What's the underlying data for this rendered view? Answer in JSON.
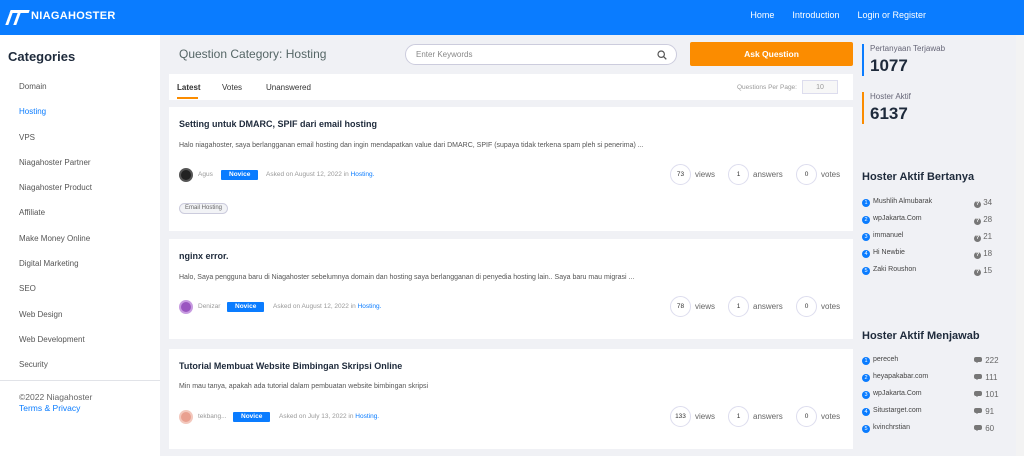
{
  "header": {
    "brand": "NIAGAHOSTER",
    "nav": [
      "Home",
      "Introduction",
      "Login or Register"
    ]
  },
  "sidebar": {
    "title": "Categories",
    "items": [
      "Domain",
      "Hosting",
      "VPS",
      "Niagahoster Partner",
      "Niagahoster Product",
      "Affiliate",
      "Make Money Online",
      "Digital Marketing",
      "SEO",
      "Web Design",
      "Web Development",
      "Security"
    ],
    "active": "Hosting",
    "copyright": "©2022 Niagahoster",
    "terms": "Terms & Privacy"
  },
  "main": {
    "title": "Question Category: Hosting",
    "search_placeholder": "Enter Keywords",
    "ask_label": "Ask Question",
    "tabs": [
      "Latest",
      "Votes",
      "Unanswered"
    ],
    "per_page_label": "Questions Per Page:",
    "per_page_value": "10"
  },
  "questions": [
    {
      "title": "Setting untuk DMARC, SPIF dari email hosting",
      "excerpt": "Halo niagahoster, saya berlangganan email hosting dan ingin mendapatkan value dari DMARC, SPIF (supaya tidak terkena spam pleh si penerima) ...",
      "author": "Agus",
      "badge": "Novice",
      "asked_prefix": "Asked on August 12, 2022 in",
      "category": "Hosting.",
      "views": "73",
      "answers": "1",
      "votes": "0",
      "tag": "Email Hosting"
    },
    {
      "title": "nginx error.",
      "excerpt": "Halo, Saya pengguna baru di Niagahoster sebelumnya domain dan hosting saya berlangganan di penyedia hosting lain.. Saya baru mau migrasi ...",
      "author": "Denizar",
      "badge": "Novice",
      "asked_prefix": "Asked on August 12, 2022 in",
      "category": "Hosting.",
      "views": "78",
      "answers": "1",
      "votes": "0"
    },
    {
      "title": "Tutorial Membuat Website Bimbingan Skripsi Online",
      "excerpt": "Min mau tanya, apakah ada tutorial dalam pembuatan website bimbingan skripsi",
      "author": "tekbang...",
      "badge": "Novice",
      "asked_prefix": "Asked on July 13, 2022 in",
      "category": "Hosting.",
      "views": "133",
      "answers": "1",
      "votes": "0"
    }
  ],
  "stat_labels": {
    "views": "views",
    "answers": "answers",
    "votes": "votes"
  },
  "stats": {
    "answered_label": "Pertanyaan Terjawab",
    "answered_value": "1077",
    "active_label": "Hoster Aktif",
    "active_value": "6137"
  },
  "ask_ranking": {
    "title": "Hoster Aktif Bertanya",
    "items": [
      {
        "name": "Mushlih Almubarak",
        "count": "34"
      },
      {
        "name": "wpJakarta.Com",
        "count": "28"
      },
      {
        "name": "immanuel",
        "count": "21"
      },
      {
        "name": "Hi Newbie",
        "count": "18"
      },
      {
        "name": "Zaki Roushon",
        "count": "15"
      }
    ]
  },
  "answer_ranking": {
    "title": "Hoster Aktif Menjawab",
    "items": [
      {
        "name": "pereceh",
        "count": "222"
      },
      {
        "name": "heyapakabar.com",
        "count": "111"
      },
      {
        "name": "wpJakarta.Com",
        "count": "101"
      },
      {
        "name": "Situstarget.com",
        "count": "91"
      },
      {
        "name": "kvinchrstian",
        "count": "60"
      }
    ]
  },
  "colors": {
    "primary": "#0a7cff",
    "accent": "#fb8c00"
  }
}
